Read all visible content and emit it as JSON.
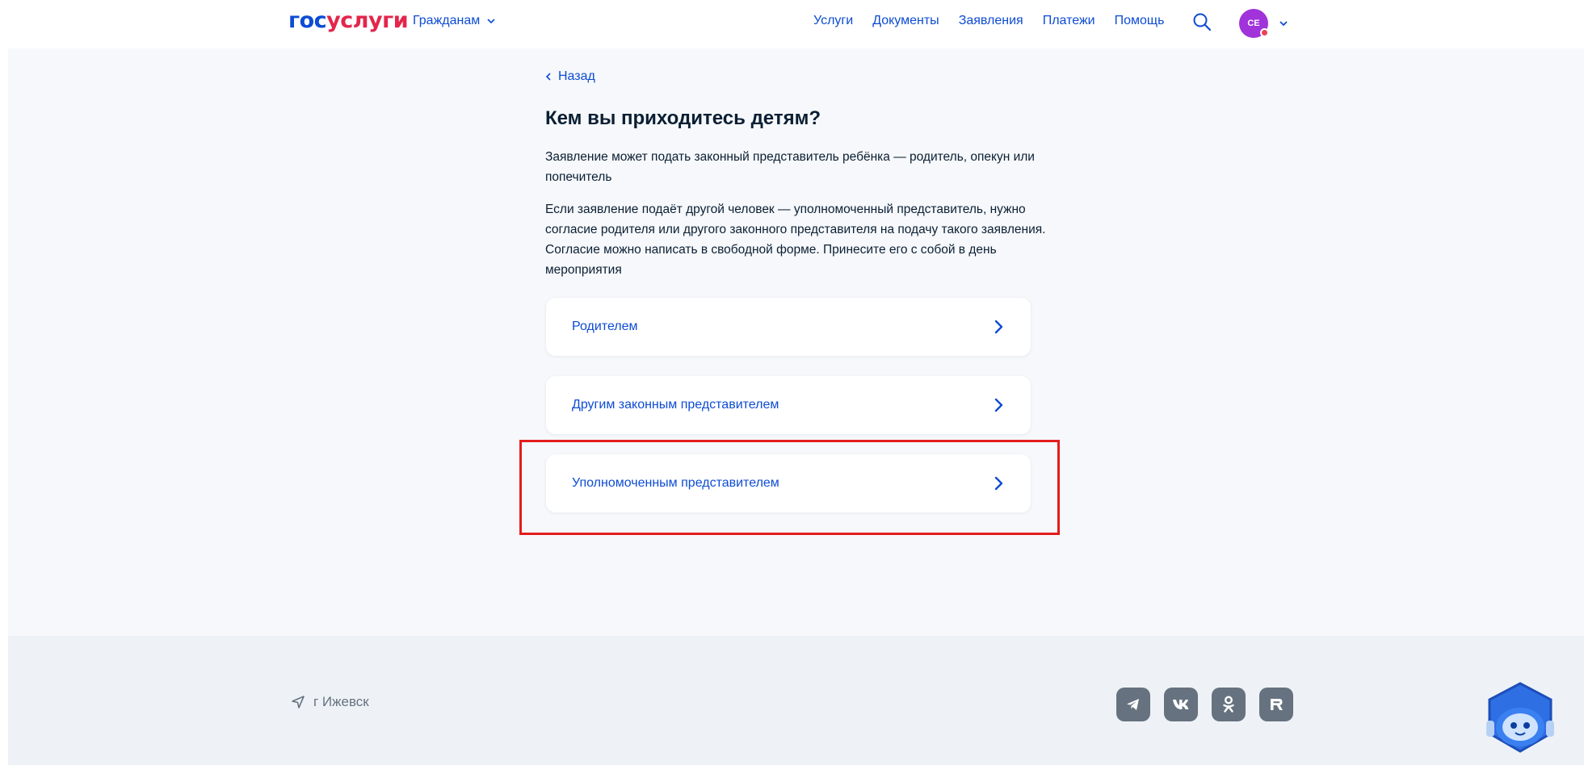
{
  "header": {
    "logo_part1": "гос",
    "logo_part2": "услуги",
    "citizens_menu": "Гражданам",
    "nav": [
      "Услуги",
      "Документы",
      "Заявления",
      "Платежи",
      "Помощь"
    ],
    "avatar_initials": "СЕ"
  },
  "main": {
    "back_label": "Назад",
    "title": "Кем вы приходитесь детям?",
    "paragraph1": "Заявление может подать законный представитель ребёнка — родитель, опекун или попечитель",
    "paragraph2": "Если заявление подаёт другой человек — уполномоченный представитель, нужно согласие родителя или другого законного представителя на подачу такого заявления. Согласие можно написать в свободной форме. Принесите его с собой в день мероприятия",
    "options": [
      {
        "label": "Родителем"
      },
      {
        "label": "Другим законным представителем"
      },
      {
        "label": "Уполномоченным представителем"
      }
    ]
  },
  "footer": {
    "city": "г Ижевск",
    "socials": [
      "telegram-icon",
      "vk-icon",
      "ok-icon",
      "rutube-icon"
    ]
  },
  "colors": {
    "accent": "#0d4cd3",
    "brand_red": "#e3264b",
    "highlight": "#e41c1c",
    "page_bg": "#f6f8fb"
  }
}
